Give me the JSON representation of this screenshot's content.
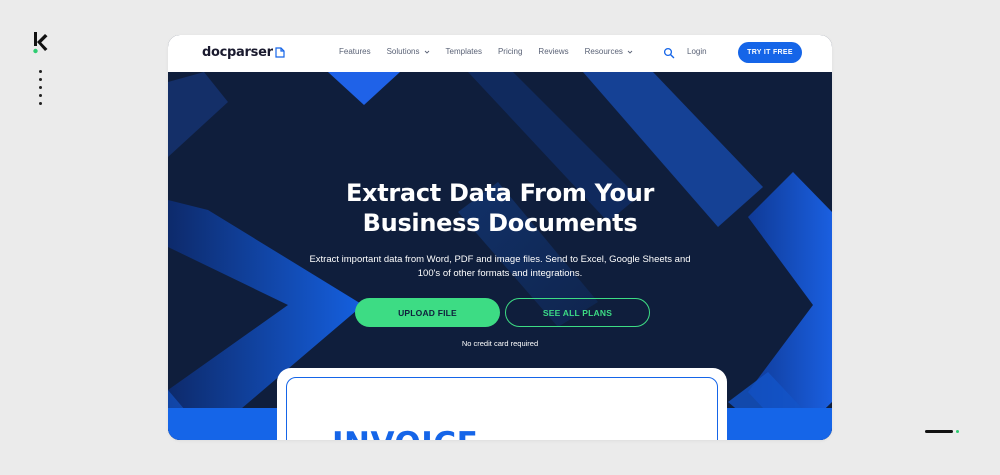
{
  "brand": {
    "name_part1": "doc",
    "name_part2": "parser"
  },
  "nav": {
    "items": [
      {
        "label": "Features",
        "dropdown": false
      },
      {
        "label": "Solutions",
        "dropdown": true
      },
      {
        "label": "Templates",
        "dropdown": false
      },
      {
        "label": "Pricing",
        "dropdown": false
      },
      {
        "label": "Reviews",
        "dropdown": false
      },
      {
        "label": "Resources",
        "dropdown": true
      }
    ],
    "login": "Login",
    "cta": "TRY IT FREE"
  },
  "hero": {
    "headline_line1": "Extract Data From Your",
    "headline_line2": "Business Documents",
    "subtext_line1": "Extract important data from Word, PDF and image files. Send to Excel, Google Sheets and",
    "subtext_line2": "100's of other formats and integrations.",
    "upload_button": "UPLOAD FILE",
    "plans_button": "SEE ALL PLANS",
    "note": "No credit card required"
  },
  "invoice": {
    "title": "INVOICE"
  },
  "colors": {
    "accent_blue": "#1565e8",
    "accent_green": "#3ddc84",
    "hero_navy": "#0f1e3c",
    "page_bg": "#ebebeb"
  }
}
